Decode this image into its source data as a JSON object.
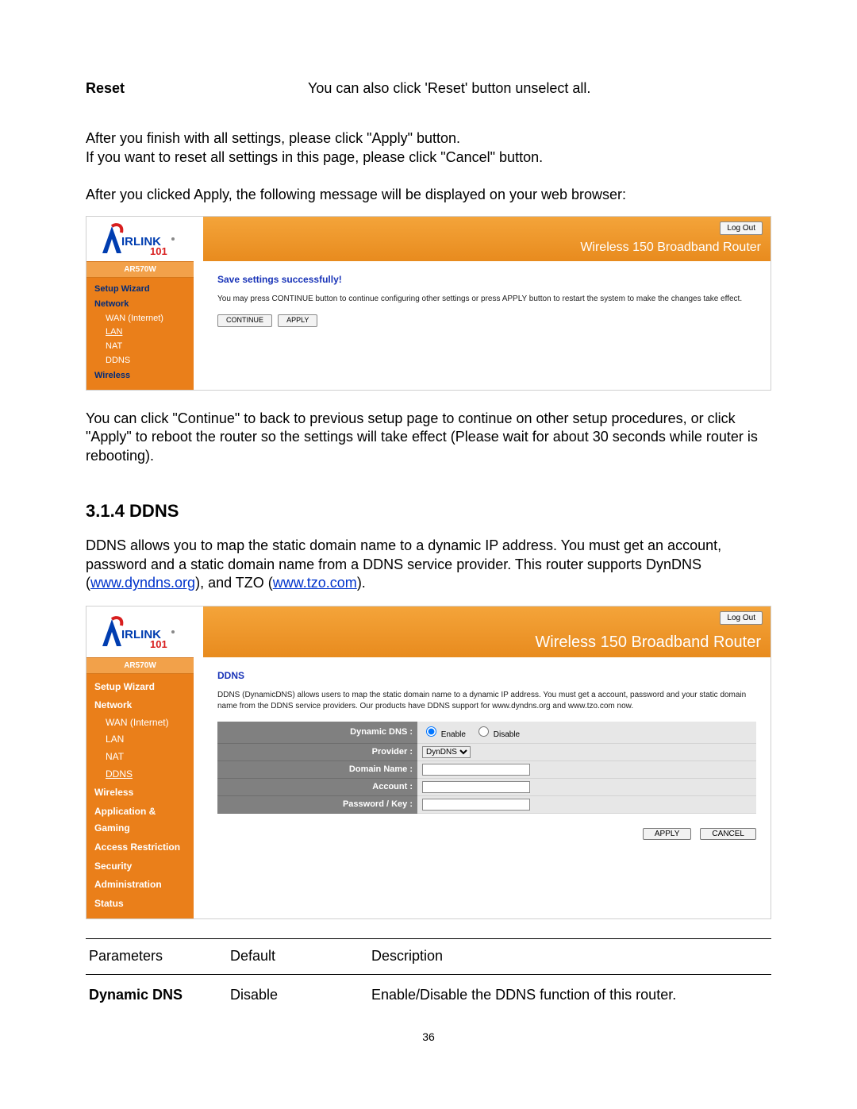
{
  "reset_row": {
    "label": "Reset",
    "desc": "You can also click 'Reset' button unselect all."
  },
  "para1_line1": "After you finish with all settings, please click \"Apply\" button.",
  "para1_line2": "If you want to reset all settings in this page, please click \"Cancel\" button.",
  "para2": "After you clicked Apply, the following message will be displayed on your web browser:",
  "router1": {
    "logout": "Log Out",
    "banner_title": "Wireless 150 Broadband Router",
    "model": "AR570W",
    "nav": {
      "setup_wizard": "Setup Wizard",
      "network": "Network",
      "wan": "WAN (Internet)",
      "lan": "LAN",
      "nat": "NAT",
      "ddns": "DDNS",
      "wireless": "Wireless"
    },
    "heading": "Save settings successfully!",
    "msg": "You may press CONTINUE button to continue configuring other settings or press APPLY button to restart the system to make the changes take effect.",
    "btn_continue": "CONTINUE",
    "btn_apply": "APPLY"
  },
  "para3": "You can click \"Continue\" to back to previous setup page to continue on other setup procedures, or click \"Apply\" to reboot the router so the settings will take effect (Please wait for about 30 seconds while router is rebooting).",
  "section_heading": "3.1.4 DDNS",
  "ddns_intro_pre": "DDNS allows you to map the static domain name to a dynamic IP address. You must get an account, password and a static domain name from a DDNS service provider. This router supports DynDNS (",
  "ddns_link1": "www.dyndns.org",
  "ddns_intro_mid": "), and TZO (",
  "ddns_link2": "www.tzo.com",
  "ddns_intro_post": ").",
  "router2": {
    "logout": "Log Out",
    "banner_title": "Wireless 150 Broadband Router",
    "model": "AR570W",
    "nav": {
      "setup_wizard": "Setup Wizard",
      "network": "Network",
      "wan": "WAN (Internet)",
      "lan": "LAN",
      "nat": "NAT",
      "ddns": "DDNS",
      "wireless": "Wireless",
      "app_gaming": "Application & Gaming",
      "access": "Access Restriction",
      "security": "Security",
      "admin": "Administration",
      "status": "Status"
    },
    "heading": "DDNS",
    "msg": "DDNS (DynamicDNS) allows users to map the static domain name to a dynamic IP address. You must get a account, password and your static domain name from the DDNS service providers. Our products have DDNS support for www.dyndns.org and www.tzo.com now.",
    "form": {
      "dynamic_dns": "Dynamic DNS :",
      "enable": "Enable",
      "disable": "Disable",
      "provider": "Provider :",
      "provider_value": "DynDNS",
      "domain_name": "Domain Name :",
      "account": "Account :",
      "password": "Password / Key :"
    },
    "btn_apply": "APPLY",
    "btn_cancel": "CANCEL"
  },
  "params_table": {
    "h1": "Parameters",
    "h2": "Default",
    "h3": "Description",
    "r1c1": "Dynamic DNS",
    "r1c2": "Disable",
    "r1c3": "Enable/Disable the DDNS function of this router."
  },
  "page_num": "36"
}
